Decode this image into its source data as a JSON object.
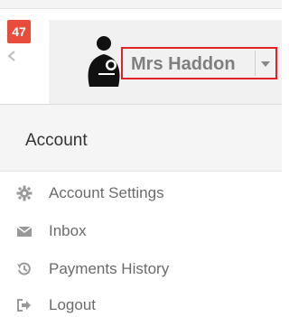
{
  "notifications": {
    "count": "47"
  },
  "user": {
    "name": "Mrs Haddon"
  },
  "menu": {
    "section_title": "Account",
    "items": [
      {
        "label": "Account Settings",
        "icon": "gear-icon"
      },
      {
        "label": "Inbox",
        "icon": "envelope-icon"
      },
      {
        "label": "Payments History",
        "icon": "history-icon"
      },
      {
        "label": "Logout",
        "icon": "sign-out-icon"
      }
    ]
  },
  "colors": {
    "badge": "#e74c3c",
    "highlight_border": "#e02424",
    "header_bg": "#f1f1f1"
  }
}
